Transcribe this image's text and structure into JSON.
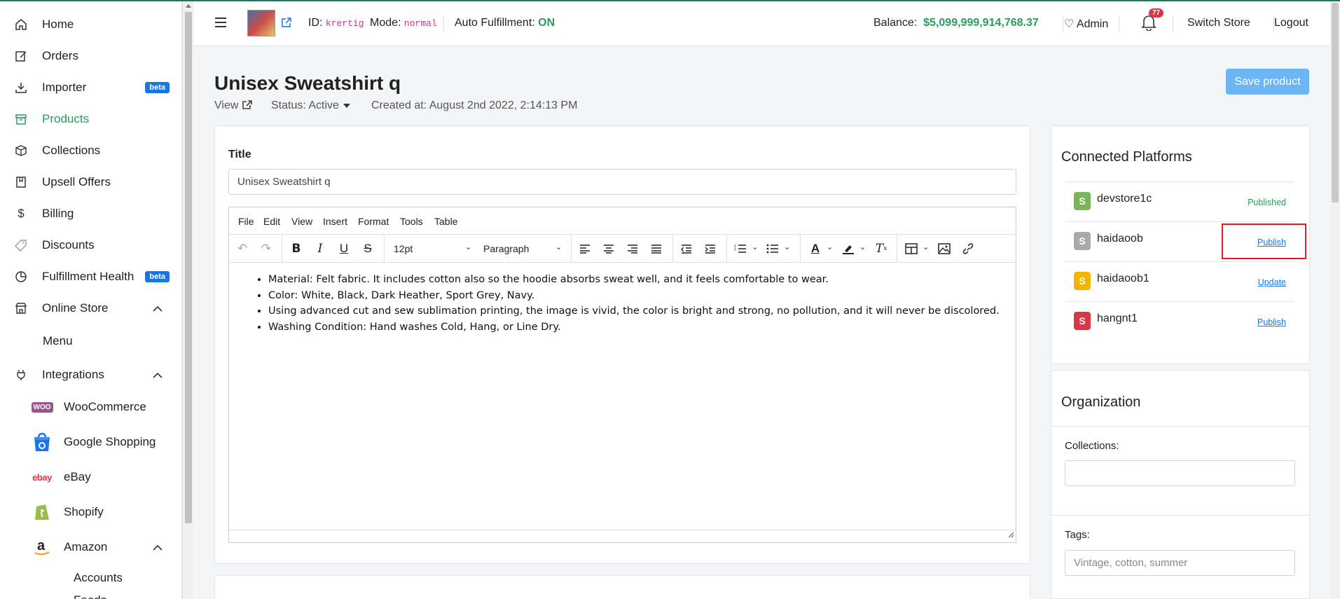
{
  "sidebar": {
    "items": [
      {
        "label": "Home"
      },
      {
        "label": "Orders"
      },
      {
        "label": "Importer",
        "badge": "beta"
      },
      {
        "label": "Products"
      },
      {
        "label": "Collections"
      },
      {
        "label": "Upsell Offers"
      },
      {
        "label": "Billing"
      },
      {
        "label": "Discounts"
      },
      {
        "label": "Fulfillment Health",
        "badge": "beta"
      },
      {
        "label": "Online Store"
      },
      {
        "label": "Menu"
      },
      {
        "label": "Integrations"
      },
      {
        "label": "WooCommerce",
        "icon_text": "WOO"
      },
      {
        "label": "Google Shopping"
      },
      {
        "label": "eBay",
        "icon_text": "ebay"
      },
      {
        "label": "Shopify"
      },
      {
        "label": "Amazon"
      },
      {
        "label": "Accounts"
      },
      {
        "label": "Feeds"
      }
    ]
  },
  "header": {
    "id_label": "ID:",
    "id_value": "krertig",
    "mode_label": "Mode:",
    "mode_value": "normal",
    "auto_label": "Auto Fulfillment:",
    "auto_value": "ON",
    "balance_label": "Balance:",
    "balance_value": "$5,099,999,914,768.37",
    "admin_label": "Admin",
    "notif_count": "77",
    "switch_store": "Switch Store",
    "logout": "Logout"
  },
  "page": {
    "title": "Unisex Sweatshirt q",
    "view_label": "View",
    "status": "Status: Active",
    "created": "Created at: August 2nd 2022, 2:14:13 PM",
    "save_button": "Save product"
  },
  "form": {
    "title_label": "Title",
    "title_value": "Unisex Sweatshirt q"
  },
  "editor": {
    "menu": [
      "File",
      "Edit",
      "View",
      "Insert",
      "Format",
      "Tools",
      "Table"
    ],
    "font_size": "12pt",
    "block_format": "Paragraph",
    "bullets": [
      "Material: Felt fabric. It includes cotton also so the hoodie absorbs sweat well, and it feels comfortable to wear.",
      "Color: White, Black, Dark Heather, Sport Grey, Navy.",
      "Using advanced cut and sew sublimation printing, the image is vivid, the color is bright and strong, no pollution, and it will never be discolored.",
      "Washing Condition: Hand washes Cold, Hang, or Line Dry."
    ]
  },
  "platforms": {
    "title": "Connected Platforms",
    "items": [
      {
        "name": "devstore1c",
        "action": "Published",
        "color": "#7ab55c"
      },
      {
        "name": "haidaoob",
        "action": "Publish",
        "color": "#a7a9ac"
      },
      {
        "name": "haidaoob1",
        "action": "Update",
        "color": "#f4b400"
      },
      {
        "name": "hangnt1",
        "action": "Publish",
        "color": "#dc3545"
      }
    ]
  },
  "organization": {
    "title": "Organization",
    "collections_label": "Collections:",
    "tags_label": "Tags:",
    "tags_placeholder": "Vintage, cotton, summer"
  },
  "colors": {
    "accent_green": "#2a9d5c",
    "badge_blue": "#1577e8",
    "save_blue": "#6cb6f6",
    "highlight_red": "#e01b24"
  }
}
